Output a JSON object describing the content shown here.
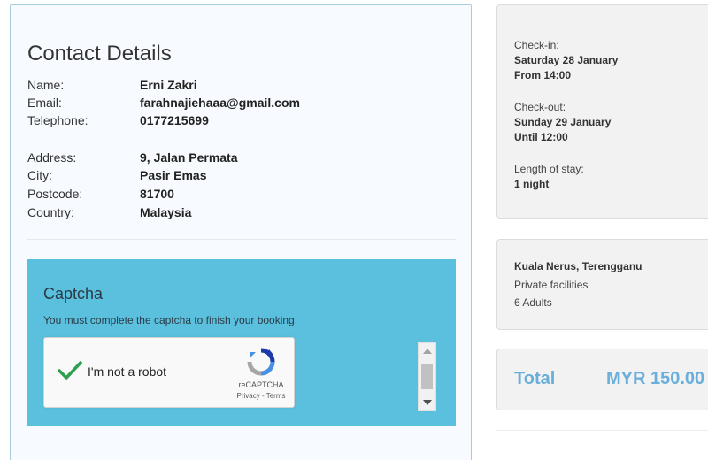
{
  "contact": {
    "title": "Contact Details",
    "fields": [
      {
        "label": "Name:",
        "value": "Erni Zakri"
      },
      {
        "label": "Email:",
        "value": "farahnajiehaaa@gmail.com"
      },
      {
        "label": "Telephone:",
        "value": "0177215699"
      },
      {
        "label": "Address:",
        "value": "9, Jalan Permata"
      },
      {
        "label": "City:",
        "value": "Pasir Emas"
      },
      {
        "label": "Postcode:",
        "value": "81700"
      },
      {
        "label": "Country:",
        "value": "Malaysia"
      }
    ]
  },
  "captcha": {
    "title": "Captcha",
    "description": "You must complete the captcha to finish your booking.",
    "checkbox_label": "I'm not a robot",
    "brand": "reCAPTCHA",
    "links": "Privacy - Terms",
    "checked": true
  },
  "stay": {
    "checkin_label": "Check-in:",
    "checkin_date": "Saturday 28 January",
    "checkin_time": "From 14:00",
    "checkout_label": "Check-out:",
    "checkout_date": "Sunday 29 January",
    "checkout_time": "Until 12:00",
    "length_label": "Length of stay:",
    "length_value": "1 night"
  },
  "property": {
    "location": "Kuala Nerus, Terengganu",
    "facilities": "Private facilities",
    "guests": "6 Adults"
  },
  "total": {
    "label": "Total",
    "amount": "MYR 150.00"
  },
  "colors": {
    "captcha_bg": "#5bc0de",
    "total_text": "#6aaedb",
    "check_green": "#2e9e4f"
  }
}
